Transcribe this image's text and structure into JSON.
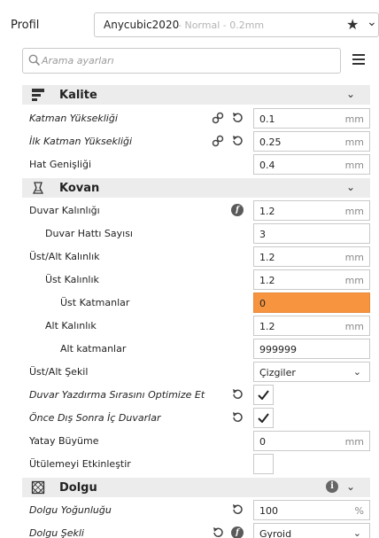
{
  "profile": {
    "label": "Profil",
    "name": "Anycubic2020",
    "subtitle": "- Normal - 0.2mm"
  },
  "search": {
    "placeholder": "Arama ayarları"
  },
  "sections": {
    "quality": {
      "title": "Kalite"
    },
    "shell": {
      "title": "Kovan"
    },
    "infill": {
      "title": "Dolgu"
    }
  },
  "rows": {
    "layer_height": {
      "label": "Katman Yüksekliği",
      "value": "0.1",
      "unit": "mm"
    },
    "initial_layer_height": {
      "label": "İlk Katman Yüksekliği",
      "value": "0.25",
      "unit": "mm"
    },
    "line_width": {
      "label": "Hat Genişliği",
      "value": "0.4",
      "unit": "mm"
    },
    "wall_thickness": {
      "label": "Duvar Kalınlığı",
      "value": "1.2",
      "unit": "mm"
    },
    "wall_line_count": {
      "label": "Duvar Hattı Sayısı",
      "value": "3"
    },
    "top_bottom_thickness": {
      "label": "Üst/Alt Kalınlık",
      "value": "1.2",
      "unit": "mm"
    },
    "top_thickness": {
      "label": "Üst Kalınlık",
      "value": "1.2",
      "unit": "mm"
    },
    "top_layers": {
      "label": "Üst Katmanlar",
      "value": "0"
    },
    "bottom_thickness": {
      "label": "Alt Kalınlık",
      "value": "1.2",
      "unit": "mm"
    },
    "bottom_layers": {
      "label": "Alt katmanlar",
      "value": "999999"
    },
    "top_bottom_pattern": {
      "label": "Üst/Alt Şekil",
      "value": "Çizgiler"
    },
    "optimize_wall_order": {
      "label": "Duvar Yazdırma Sırasını Optimize Et"
    },
    "outer_before_inner": {
      "label": "Önce Dış Sonra İç Duvarlar"
    },
    "horizontal_expansion": {
      "label": "Yatay Büyüme",
      "value": "0",
      "unit": "mm"
    },
    "ironing": {
      "label": "Ütülemeyi Etkinleştir"
    },
    "infill_density": {
      "label": "Dolgu Yoğunluğu",
      "value": "100",
      "unit": "%"
    },
    "infill_pattern": {
      "label": "Dolgu Şekli",
      "value": "Gyroid"
    }
  },
  "colors": {
    "highlight": "#f7943f",
    "section_bg": "#ececec"
  }
}
